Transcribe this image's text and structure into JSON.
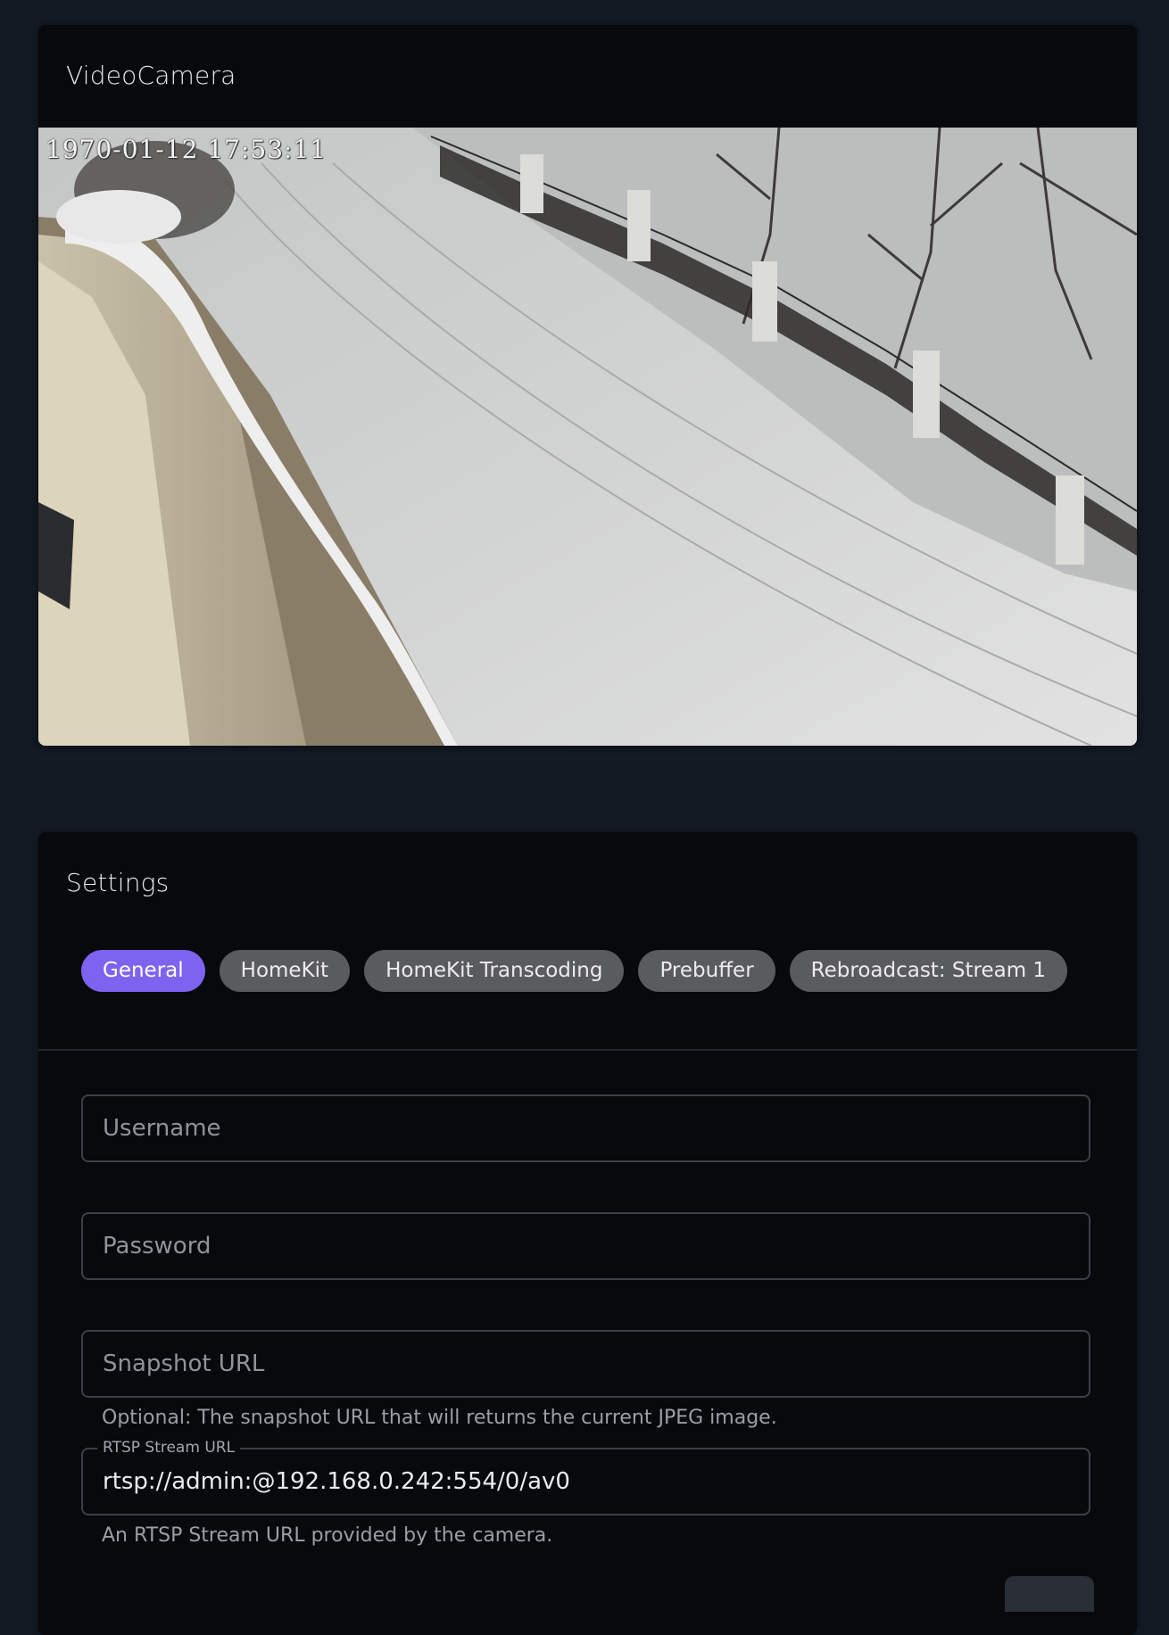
{
  "camera": {
    "title": "VideoCamera",
    "timestamp": "1970-01-12 17:53:11"
  },
  "settings": {
    "title": "Settings",
    "tabs": [
      {
        "label": "General",
        "active": true
      },
      {
        "label": "HomeKit",
        "active": false
      },
      {
        "label": "HomeKit Transcoding",
        "active": false
      },
      {
        "label": "Prebuffer",
        "active": false
      },
      {
        "label": "Rebroadcast: Stream 1",
        "active": false
      }
    ],
    "fields": {
      "username": {
        "placeholder": "Username",
        "value": ""
      },
      "password": {
        "placeholder": "Password",
        "value": ""
      },
      "snapshot_url": {
        "placeholder": "Snapshot URL",
        "value": "",
        "helper": "Optional: The snapshot URL that will returns the current JPEG image."
      },
      "rtsp_url": {
        "label": "RTSP Stream URL",
        "value": "rtsp://admin:@192.168.0.242:554/0/av0",
        "helper": "An RTSP Stream URL provided by the camera."
      }
    }
  },
  "colors": {
    "page_bg": "#131a24",
    "card_bg": "#07090c",
    "accent": "#7e63f0",
    "chip_bg": "#5a5b5e"
  }
}
